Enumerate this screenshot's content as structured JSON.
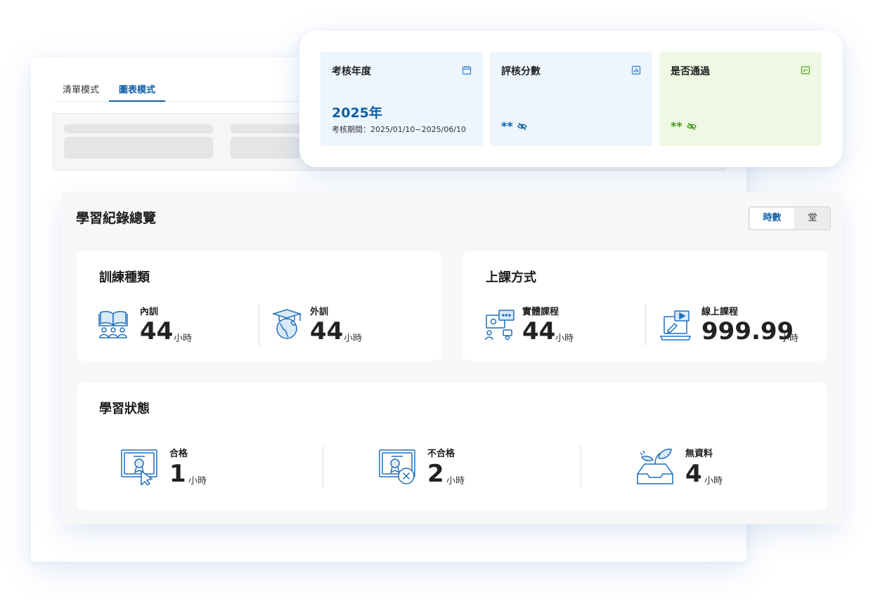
{
  "tabs": {
    "list_mode": "清單模式",
    "chart_mode": "圖表模式"
  },
  "review": {
    "year_title": "考核年度",
    "year_value": "2025年",
    "year_period": "考核期間：2025/01/10~2025/06/10",
    "score_title": "評核分數",
    "score_value": "**",
    "pass_title": "是否通過",
    "pass_value": "**"
  },
  "overview": {
    "title": "學習紀錄總覽",
    "toggle_hours": "時數",
    "toggle_sessions": "堂"
  },
  "training_type": {
    "title": "訓練種類",
    "internal_label": "內訓",
    "internal_value": "44",
    "internal_unit": "小時",
    "external_label": "外訓",
    "external_value": "44",
    "external_unit": "小時"
  },
  "class_method": {
    "title": "上課方式",
    "physical_label": "實體課程",
    "physical_value": "44",
    "physical_unit": "小時",
    "online_label": "線上課程",
    "online_value": "999.99",
    "online_unit": "小時"
  },
  "learning_status": {
    "title": "學習狀態",
    "pass_label": "合格",
    "pass_value": "1",
    "pass_unit": "小時",
    "fail_label": "不合格",
    "fail_value": "2",
    "fail_unit": "小時",
    "nodata_label": "無資料",
    "nodata_value": "4",
    "nodata_unit": "小時"
  },
  "colors": {
    "accent": "#0c5fa8",
    "green": "#3f9a18",
    "icon_blue": "#1f6fbf"
  }
}
